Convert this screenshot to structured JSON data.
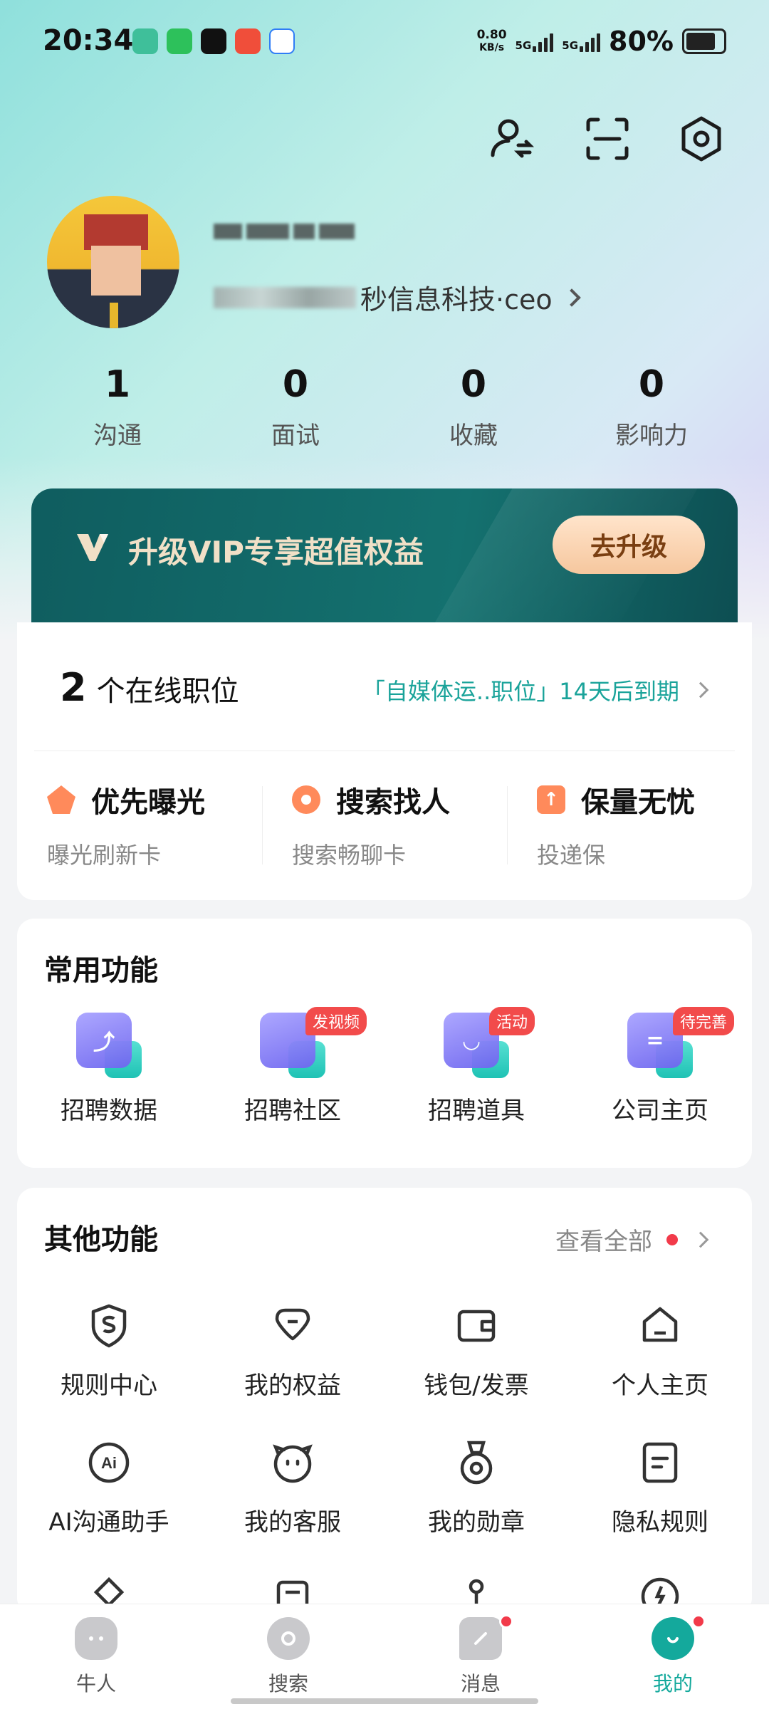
{
  "status_bar": {
    "time": "20:34",
    "net_speed_value": "0.80",
    "net_speed_unit": "KB/s",
    "network_1": "5G",
    "network_2": "5G",
    "battery": "80%"
  },
  "profile": {
    "company_suffix": "秒信息科技·ceo"
  },
  "stats": [
    {
      "value": "1",
      "label": "沟通"
    },
    {
      "value": "0",
      "label": "面试"
    },
    {
      "value": "0",
      "label": "收藏"
    },
    {
      "value": "0",
      "label": "影响力"
    }
  ],
  "vip": {
    "text": "升级VIP专享超值权益",
    "button": "去升级"
  },
  "jobs": {
    "count": "2",
    "count_label": "个在线职位",
    "expire_text": "「自媒体运..职位」14天后到期"
  },
  "perks": [
    {
      "title": "优先曝光",
      "sub": "曝光刷新卡",
      "icon": "flame-icon",
      "color": "#ff8a5b"
    },
    {
      "title": "搜索找人",
      "sub": "搜索畅聊卡",
      "icon": "target-icon",
      "color": "#ff8a5b"
    },
    {
      "title": "保量无忧",
      "sub": "投递保",
      "icon": "arrow-up-icon",
      "color": "#ff8a5b"
    }
  ],
  "common": {
    "title": "常用功能",
    "items": [
      {
        "label": "招聘数据",
        "tag": ""
      },
      {
        "label": "招聘社区",
        "tag": "发视频"
      },
      {
        "label": "招聘道具",
        "tag": "活动"
      },
      {
        "label": "公司主页",
        "tag": "待完善"
      }
    ]
  },
  "other": {
    "title": "其他功能",
    "view_all": "查看全部",
    "row1": [
      {
        "label": "规则中心",
        "icon": "shield-s-icon"
      },
      {
        "label": "我的权益",
        "icon": "diamond-icon"
      },
      {
        "label": "钱包/发票",
        "icon": "wallet-icon"
      },
      {
        "label": "个人主页",
        "icon": "home-icon"
      }
    ],
    "row2": [
      {
        "label": "AI沟通助手",
        "icon": "ai-icon"
      },
      {
        "label": "我的客服",
        "icon": "service-icon"
      },
      {
        "label": "我的勋章",
        "icon": "medal-icon"
      },
      {
        "label": "隐私规则",
        "icon": "document-icon"
      }
    ]
  },
  "nav": [
    {
      "label": "牛人"
    },
    {
      "label": "搜索"
    },
    {
      "label": "消息"
    },
    {
      "label": "我的"
    }
  ],
  "colors": {
    "accent": "#14a99c",
    "vip_bg": "#14716f",
    "badge_red": "#f24b4b"
  }
}
